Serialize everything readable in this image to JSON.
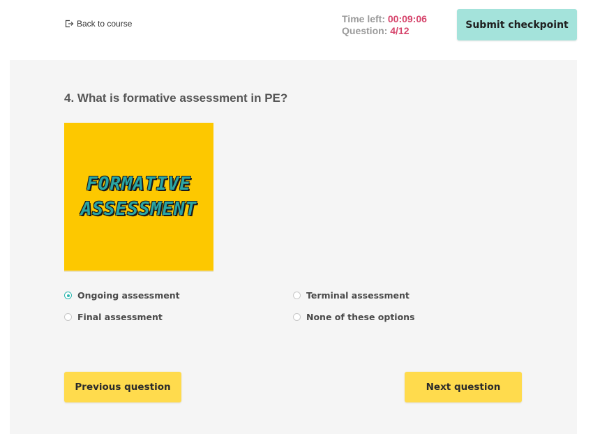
{
  "header": {
    "back_label": "Back to course",
    "back_icon": "exit-icon",
    "time_left_label": "Time left:",
    "time_left_value": "00:09:06",
    "question_label": "Question:",
    "question_value": "4/12",
    "submit_label": "Submit checkpoint"
  },
  "question": {
    "title": "4.  What is formative assessment in PE?",
    "image_text_line1": "FORMATIVE",
    "image_text_line2": "ASSESSMENT",
    "options": [
      {
        "label": "Ongoing assessment",
        "selected": true
      },
      {
        "label": "Terminal assessment",
        "selected": false
      },
      {
        "label": "Final assessment",
        "selected": false
      },
      {
        "label": "None of these options",
        "selected": false
      }
    ]
  },
  "navigation": {
    "previous_label": "Previous question",
    "next_label": "Next question"
  },
  "colors": {
    "accent_teal": "#a4e3db",
    "highlight_red": "#d6456c",
    "button_yellow": "#ffdb4d",
    "image_background": "#fdc800",
    "radio_selected": "#2fb8b0"
  }
}
